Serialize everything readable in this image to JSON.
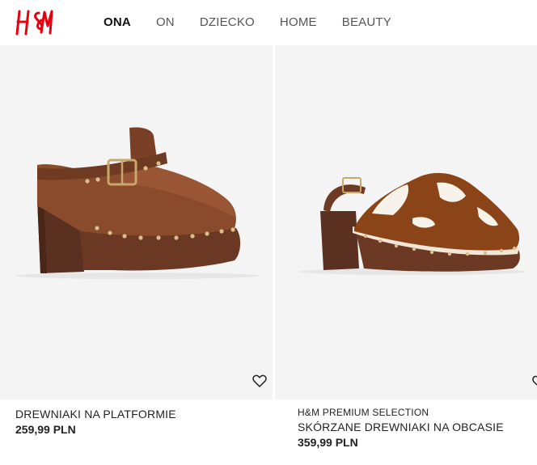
{
  "header": {
    "logo_text": "H&M",
    "nav": [
      {
        "label": "ONA",
        "active": true
      },
      {
        "label": "ON",
        "active": false
      },
      {
        "label": "DZIECKO",
        "active": false
      },
      {
        "label": "HOME",
        "active": false
      },
      {
        "label": "BEAUTY",
        "active": false
      }
    ]
  },
  "products": [
    {
      "subtitle": "",
      "title": "DREWNIAKI NA PLATFORMIE",
      "price": "259,99 PLN"
    },
    {
      "subtitle": "H&M PREMIUM SELECTION",
      "title": "SKÓRZANE DREWNIAKI NA OBCASIE",
      "price": "359,99 PLN"
    }
  ],
  "icons": {
    "favorite": "heart-outline-icon"
  },
  "colors": {
    "brand_red": "#e50010",
    "image_bg": "#f4f4f4"
  }
}
